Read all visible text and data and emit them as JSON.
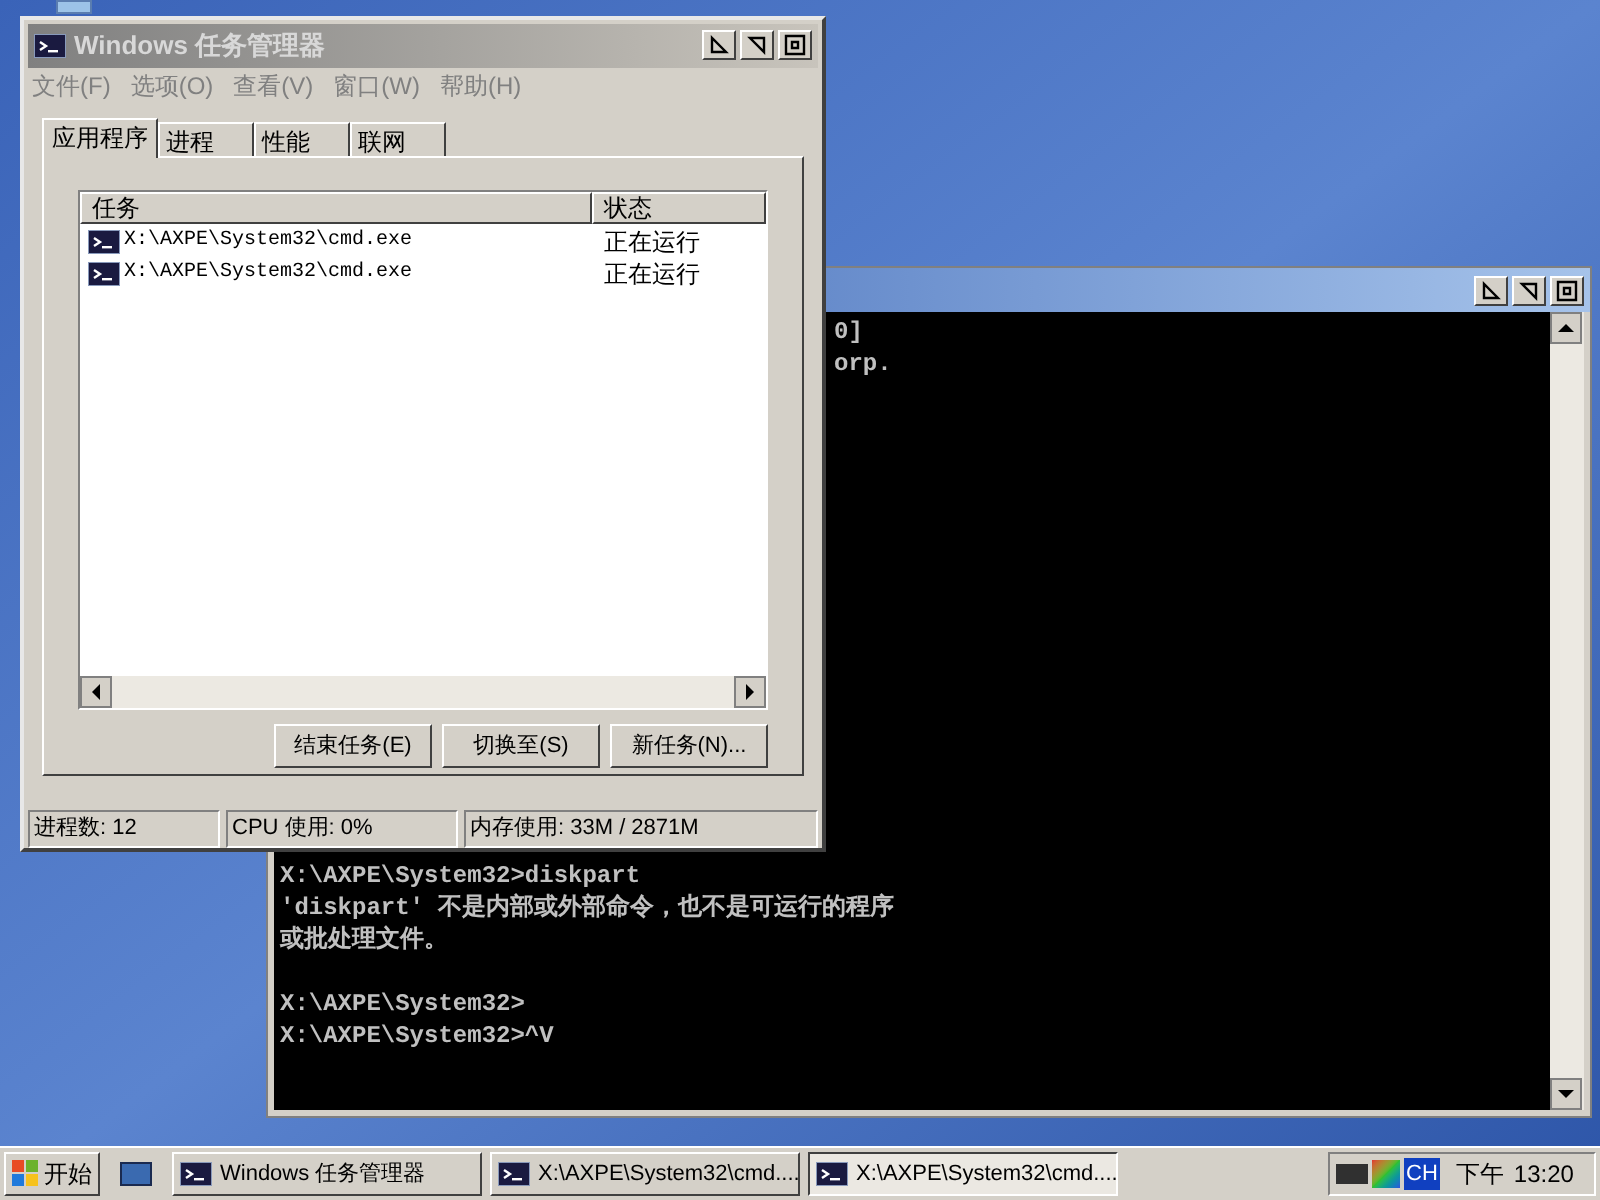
{
  "task_manager": {
    "title": "Windows 任务管理器",
    "menu": [
      "文件(F)",
      "选项(O)",
      "查看(V)",
      "窗口(W)",
      "帮助(H)"
    ],
    "tabs": [
      {
        "label": "应用程序",
        "selected": true
      },
      {
        "label": "进程",
        "selected": false
      },
      {
        "label": "性能",
        "selected": false
      },
      {
        "label": "联网",
        "selected": false
      }
    ],
    "columns": [
      "任务",
      "状态"
    ],
    "rows": [
      {
        "task": "X:\\AXPE\\System32\\cmd.exe",
        "status": "正在运行"
      },
      {
        "task": "X:\\AXPE\\System32\\cmd.exe",
        "status": "正在运行"
      }
    ],
    "buttons": [
      "结束任务(E)",
      "切换至(S)",
      "新任务(N)..."
    ],
    "status_bar": [
      "进程数: 12",
      "CPU 使用: 0%",
      "内存使用: 33M / 2871M"
    ]
  },
  "console": {
    "top_fragments": [
      "0]",
      "orp."
    ],
    "blocks": [
      [
        "X:\\AXPE\\System32>diskpart",
        "'diskpart' 不是内部或外部命令，也不是可运行的程序",
        "或批处理文件。"
      ],
      [
        "X:\\AXPE\\System32>",
        "X:\\AXPE\\System32>^V"
      ]
    ]
  },
  "taskbar": {
    "start": "开始",
    "tasks": [
      {
        "label": "Windows 任务管理器",
        "selected": false
      },
      {
        "label": "X:\\AXPE\\System32\\cmd....",
        "selected": false
      },
      {
        "label": "X:\\AXPE\\System32\\cmd....",
        "selected": true
      }
    ],
    "tray": {
      "language": "CH",
      "period": "下午",
      "time": "13:20"
    }
  }
}
